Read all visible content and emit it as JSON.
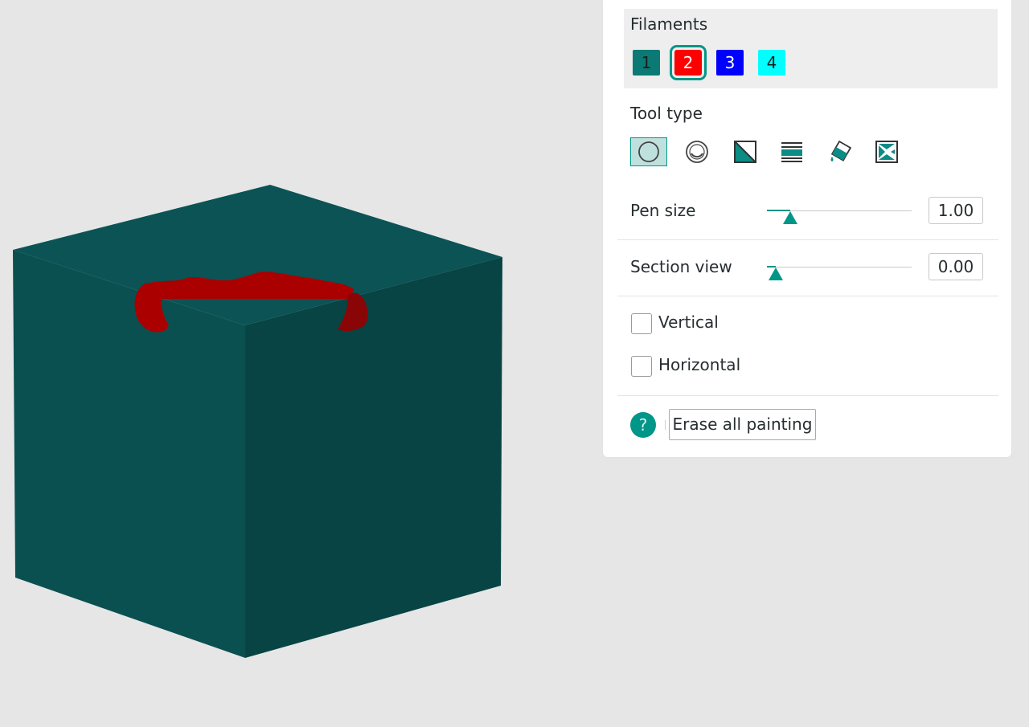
{
  "colors": {
    "background": "#e6e6e6",
    "accent": "#009688",
    "cube_top": "#0b5355",
    "cube_left": "#0a5051",
    "cube_right": "#084444",
    "paint": "#aa0000",
    "paint_dark": "#8a0505"
  },
  "filaments": {
    "title": "Filaments",
    "items": [
      {
        "label": "1",
        "color": "#0b7a74",
        "text_color": "#1c1c1c",
        "selected": false
      },
      {
        "label": "2",
        "color": "#ff0000",
        "text_color": "#ffffff",
        "selected": true
      },
      {
        "label": "3",
        "color": "#0000ff",
        "text_color": "#ffffff",
        "selected": false
      },
      {
        "label": "4",
        "color": "#00ffff",
        "text_color": "#1c1c1c",
        "selected": false
      }
    ]
  },
  "tool_type": {
    "title": "Tool type",
    "tools": [
      {
        "icon": "circle-brush-icon",
        "active": true
      },
      {
        "icon": "sphere-brush-icon",
        "active": false
      },
      {
        "icon": "triangle-fill-icon",
        "active": false
      },
      {
        "icon": "gap-fill-icon",
        "active": false
      },
      {
        "icon": "bucket-fill-icon",
        "active": false
      },
      {
        "icon": "smart-fill-icon",
        "active": false
      }
    ]
  },
  "pen_size": {
    "label": "Pen size",
    "value": "1.00",
    "fraction": 0.16
  },
  "section_view": {
    "label": "Section view",
    "value": "0.00",
    "fraction": 0.06
  },
  "vertical": {
    "label": "Vertical",
    "checked": false
  },
  "horizontal": {
    "label": "Horizontal",
    "checked": false
  },
  "help": {
    "glyph": "?"
  },
  "erase": {
    "label": "Erase all painting"
  }
}
